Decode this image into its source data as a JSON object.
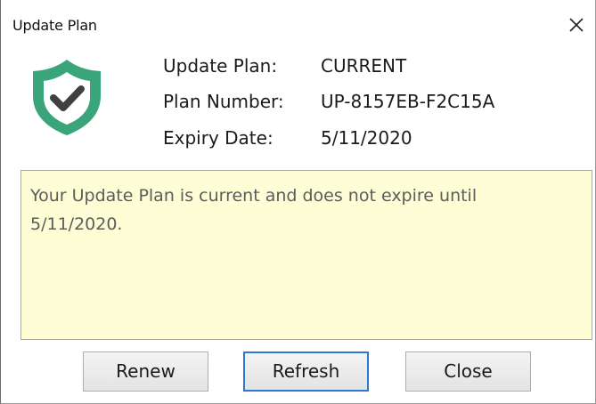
{
  "window": {
    "title": "Update Plan"
  },
  "info": {
    "plan_label": "Update Plan:",
    "plan_value": "CURRENT",
    "number_label": "Plan Number:",
    "number_value": "UP-8157EB-F2C15A",
    "expiry_label": "Expiry Date:",
    "expiry_value": "5/11/2020"
  },
  "message": "Your Update Plan is current and does not expire until 5/11/2020.",
  "buttons": {
    "renew": "Renew",
    "refresh": "Refresh",
    "close": "Close"
  },
  "icons": {
    "status": "shield-check-icon",
    "close": "close-icon"
  },
  "colors": {
    "shield": "#3aa57a",
    "message_background": "#fdfdd6",
    "default_button_border": "#2a78d6"
  }
}
